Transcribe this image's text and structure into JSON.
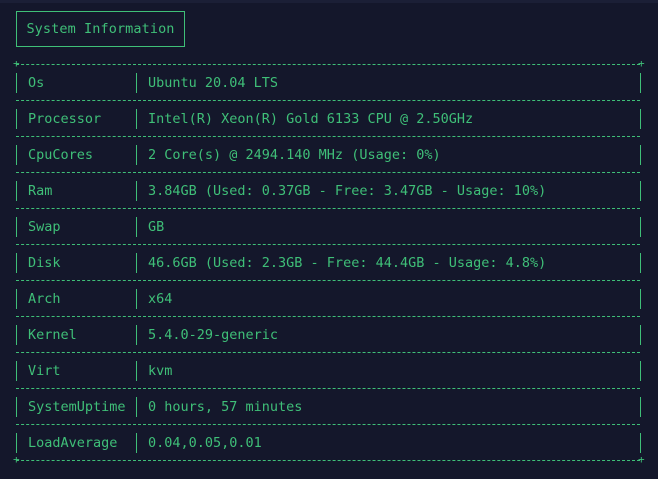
{
  "header": {
    "title": "System Information"
  },
  "rows": [
    {
      "label": "Os",
      "value": "Ubuntu 20.04 LTS"
    },
    {
      "label": "Processor",
      "value": "Intel(R) Xeon(R) Gold 6133 CPU @ 2.50GHz"
    },
    {
      "label": "CpuCores",
      "value": "2 Core(s) @ 2494.140 MHz (Usage: 0%)"
    },
    {
      "label": "Ram",
      "value": "3.84GB (Used: 0.37GB - Free: 3.47GB - Usage: 10%)"
    },
    {
      "label": "Swap",
      "value": "GB"
    },
    {
      "label": "Disk",
      "value": "46.6GB (Used: 2.3GB - Free: 44.4GB - Usage: 4.8%)"
    },
    {
      "label": "Arch",
      "value": "x64"
    },
    {
      "label": "Kernel",
      "value": "5.4.0-29-generic"
    },
    {
      "label": "Virt",
      "value": "kvm"
    },
    {
      "label": "SystemUptime",
      "value": "0 hours, 57 minutes"
    },
    {
      "label": "LoadAverage",
      "value": "0.04,0.05,0.01"
    }
  ],
  "colors": {
    "background": "#14172b",
    "text": "#3fbf78"
  }
}
